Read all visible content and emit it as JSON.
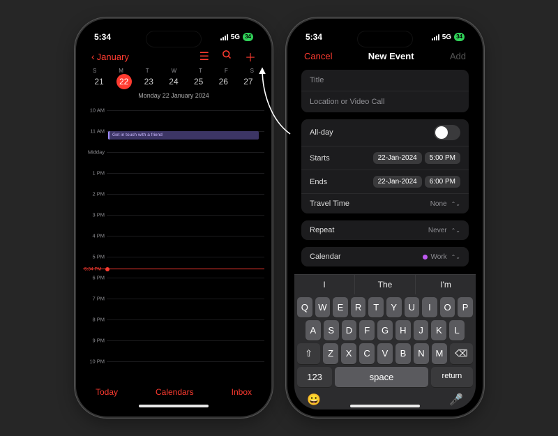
{
  "status": {
    "time": "5:34",
    "network": "5G",
    "battery": "34"
  },
  "left": {
    "back_label": "January",
    "weekday_labels": [
      "S",
      "M",
      "T",
      "W",
      "T",
      "F",
      "S"
    ],
    "dates": [
      "21",
      "22",
      "23",
      "24",
      "25",
      "26",
      "27"
    ],
    "selected_index": 1,
    "date_header": "Monday  22 January 2024",
    "event_title": "Get in touch with a friend",
    "now_label": "5:34 PM",
    "hours": [
      "10 AM",
      "11 AM",
      "Midday",
      "1 PM",
      "2 PM",
      "3 PM",
      "4 PM",
      "5 PM",
      "6 PM",
      "7 PM",
      "8 PM",
      "9 PM",
      "10 PM"
    ],
    "bottom": {
      "today": "Today",
      "calendars": "Calendars",
      "inbox": "Inbox"
    }
  },
  "right": {
    "cancel": "Cancel",
    "title": "New Event",
    "add": "Add",
    "title_ph": "Title",
    "location_ph": "Location or Video Call",
    "allday": "All-day",
    "starts": "Starts",
    "start_date": "22-Jan-2024",
    "start_time": "5:00 PM",
    "ends": "Ends",
    "end_date": "22-Jan-2024",
    "end_time": "6:00 PM",
    "travel": "Travel Time",
    "travel_val": "None",
    "repeat": "Repeat",
    "repeat_val": "Never",
    "calendar": "Calendar",
    "calendar_val": "Work"
  },
  "keyboard": {
    "pred": [
      "I",
      "The",
      "I'm"
    ],
    "r1": [
      "Q",
      "W",
      "E",
      "R",
      "T",
      "Y",
      "U",
      "I",
      "O",
      "P"
    ],
    "r2": [
      "A",
      "S",
      "D",
      "F",
      "G",
      "H",
      "J",
      "K",
      "L"
    ],
    "r3": [
      "Z",
      "X",
      "C",
      "V",
      "B",
      "N",
      "M"
    ],
    "num": "123",
    "space": "space",
    "ret": "return"
  }
}
